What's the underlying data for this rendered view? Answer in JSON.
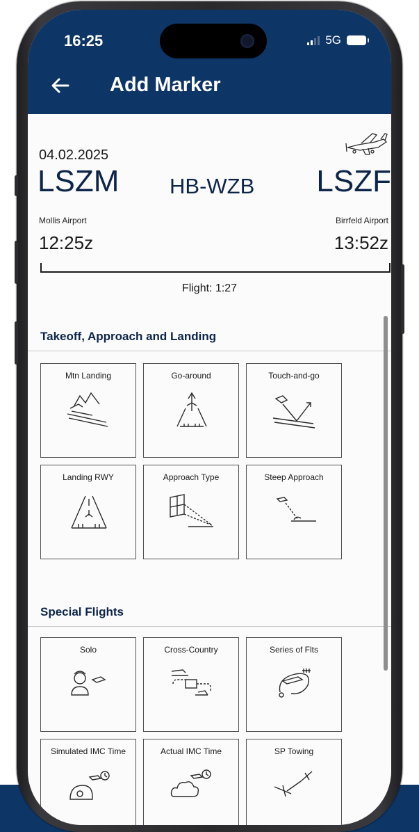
{
  "status_bar": {
    "time": "16:25",
    "network": "5G"
  },
  "header": {
    "title": "Add Marker"
  },
  "flight": {
    "date": "04.02.2025",
    "from_code": "LSZM",
    "from_name": "Mollis Airport",
    "registration": "HB-WZB",
    "to_code": "LSZF",
    "to_name": "Birrfeld Airport",
    "departure_time": "12:25z",
    "arrival_time": "13:52z",
    "duration": "Flight: 1:27"
  },
  "sections": [
    {
      "title": "Takeoff, Approach and Landing",
      "tiles": [
        {
          "label": "Mtn Landing",
          "icon": "mountain-landing-icon"
        },
        {
          "label": "Go-around",
          "icon": "go-around-icon"
        },
        {
          "label": "Touch-and-go",
          "icon": "touch-and-go-icon"
        },
        {
          "label": "Landing RWY",
          "icon": "runway-icon"
        },
        {
          "label": "Approach Type",
          "icon": "approach-type-icon"
        },
        {
          "label": "Steep Approach",
          "icon": "steep-approach-icon"
        }
      ]
    },
    {
      "title": "Special Flights",
      "tiles": [
        {
          "label": "Solo",
          "icon": "solo-pilot-icon"
        },
        {
          "label": "Cross-Country",
          "icon": "cross-country-icon"
        },
        {
          "label": "Series of Flts",
          "icon": "series-of-flights-icon"
        },
        {
          "label": "Simulated IMC Time",
          "icon": "simulated-imc-icon"
        },
        {
          "label": "Actual IMC Time",
          "icon": "actual-imc-icon"
        },
        {
          "label": "SP Towing",
          "icon": "towing-icon"
        }
      ]
    }
  ],
  "colors": {
    "header_bg": "#0d3566",
    "accent_text": "#0d2548",
    "tile_border": "#505050"
  }
}
